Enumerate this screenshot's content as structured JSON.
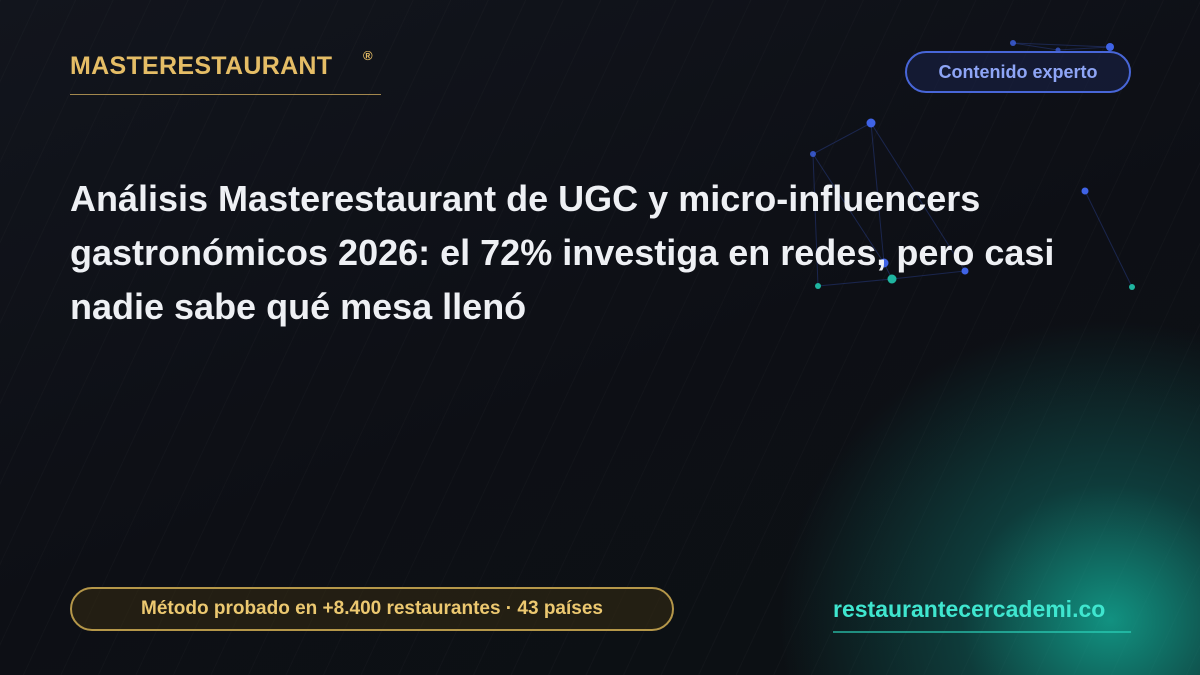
{
  "brand": {
    "name": "MASTERESTAURANT",
    "mark": "®",
    "color": "#e5bd66"
  },
  "badge": {
    "label": "Contenido experto",
    "color": "#8ea5f6"
  },
  "headline": "Análisis Masterestaurant de UGC y micro-influencers gastronómicos 2026: el 72% investiga en redes, pero casi nadie sabe qué mesa llenó",
  "proof": {
    "label": "Método probado en +8.400 restaurantes · 43 países",
    "color": "#ecc870"
  },
  "site": {
    "url": "restaurantecercademi.co",
    "color": "#3fe6cf"
  },
  "colors": {
    "background": "#0d0f15",
    "glow": "#14c8af",
    "network_blue": "#3f63e6",
    "network_teal": "#1fb5a0"
  }
}
